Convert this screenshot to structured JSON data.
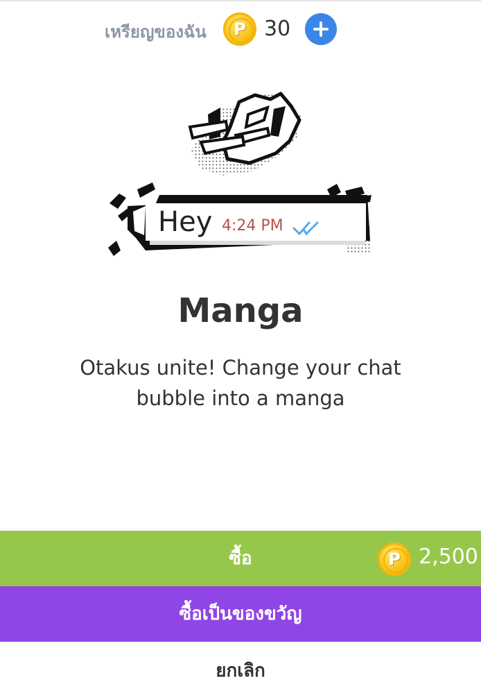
{
  "wallet": {
    "label": "เหรียญของฉัน",
    "coin_symbol": "P",
    "balance": "30"
  },
  "preview": {
    "message": "Hey",
    "time": "4:24 PM"
  },
  "item": {
    "title": "Manga",
    "description": "Otakus unite! Change your chat bubble into a manga"
  },
  "actions": {
    "buy_label": "ซื้อ",
    "price": "2,500",
    "gift_label": "ซื้อเป็นของขวัญ",
    "cancel_label": "ยกเลิก"
  },
  "colors": {
    "buy": "#97c74a",
    "gift": "#9046e6",
    "add": "#3a86e8",
    "coin": "#f7c21a",
    "time": "#b5524b",
    "check": "#5aa8e6"
  }
}
